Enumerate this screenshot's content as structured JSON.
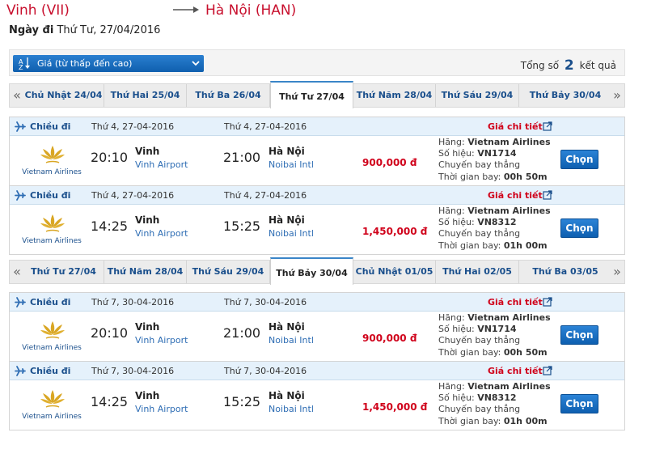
{
  "route": {
    "from": "Vinh (VII)",
    "to": "Hà Nội (HAN)"
  },
  "depart": {
    "label": "Ngày đi",
    "value": "Thứ Tư, 27/04/2016"
  },
  "sort": {
    "label": "Giá (từ thấp đến cao)"
  },
  "results": {
    "prefix": "Tổng số",
    "count": "2",
    "suffix": "kết quả"
  },
  "tabs1": [
    "Chủ Nhật 24/04",
    "Thứ Hai 25/04",
    "Thứ Ba 26/04",
    "Thứ Tư 27/04",
    "Thứ Năm 28/04",
    "Thứ Sáu 29/04",
    "Thứ Bảy 30/04"
  ],
  "tabs2": [
    "Thứ Tư 27/04",
    "Thứ Năm 28/04",
    "Thứ Sáu 29/04",
    "Thứ Bảy 30/04",
    "Chủ Nhật 01/05",
    "Thứ Hai 02/05",
    "Thứ Ba 03/05"
  ],
  "active_tab_1": "Thứ Tư 27/04",
  "active_tab_2": "Thứ Bảy 30/04",
  "nav": {
    "prev": "«",
    "next": "»"
  },
  "labels": {
    "direction": "Chiều đi",
    "detail": "Giá chi tiết",
    "airline_label": "Hãng:",
    "flight_no_label": "Số hiệu:",
    "direct": "Chuyến bay thẳng",
    "duration_label": "Thời gian bay:",
    "select": "Chọn",
    "logo": "Vietnam Airlines"
  },
  "flights": [
    {
      "date_dep": "Thứ 4, 27-04-2016",
      "date_arr": "Thứ 4, 27-04-2016",
      "dep_time": "20:10",
      "dep_city": "Vinh",
      "dep_airport": "Vinh Airport",
      "arr_time": "21:00",
      "arr_city": "Hà Nội",
      "arr_airport": "Noibai Intl",
      "price": "900,000 đ",
      "airline": "Vietnam Airlines",
      "flight_no": "VN1714",
      "duration": "00h 50m"
    },
    {
      "date_dep": "Thứ 4, 27-04-2016",
      "date_arr": "Thứ 4, 27-04-2016",
      "dep_time": "14:25",
      "dep_city": "Vinh",
      "dep_airport": "Vinh Airport",
      "arr_time": "15:25",
      "arr_city": "Hà Nội",
      "arr_airport": "Noibai Intl",
      "price": "1,450,000 đ",
      "airline": "Vietnam Airlines",
      "flight_no": "VN8312",
      "duration": "01h 00m"
    },
    {
      "date_dep": "Thứ 7, 30-04-2016",
      "date_arr": "Thứ 7, 30-04-2016",
      "dep_time": "20:10",
      "dep_city": "Vinh",
      "dep_airport": "Vinh Airport",
      "arr_time": "21:00",
      "arr_city": "Hà Nội",
      "arr_airport": "Noibai Intl",
      "price": "900,000 đ",
      "airline": "Vietnam Airlines",
      "flight_no": "VN1714",
      "duration": "00h 50m"
    },
    {
      "date_dep": "Thứ 7, 30-04-2016",
      "date_arr": "Thứ 7, 30-04-2016",
      "dep_time": "14:25",
      "dep_city": "Vinh",
      "dep_airport": "Vinh Airport",
      "arr_time": "15:25",
      "arr_city": "Hà Nội",
      "arr_airport": "Noibai Intl",
      "price": "1,450,000 đ",
      "airline": "Vietnam Airlines",
      "flight_no": "VN8312",
      "duration": "01h 00m"
    }
  ],
  "colors": {
    "accent": "#c8102e",
    "brand": "#1a4f8c",
    "button": "#1167c2",
    "header_bg": "#e5f1fb"
  },
  "icons": {
    "plane": "plane-icon",
    "detail": "external-link-icon",
    "sort": "sort-icon",
    "chevron": "chevron-down-icon"
  }
}
